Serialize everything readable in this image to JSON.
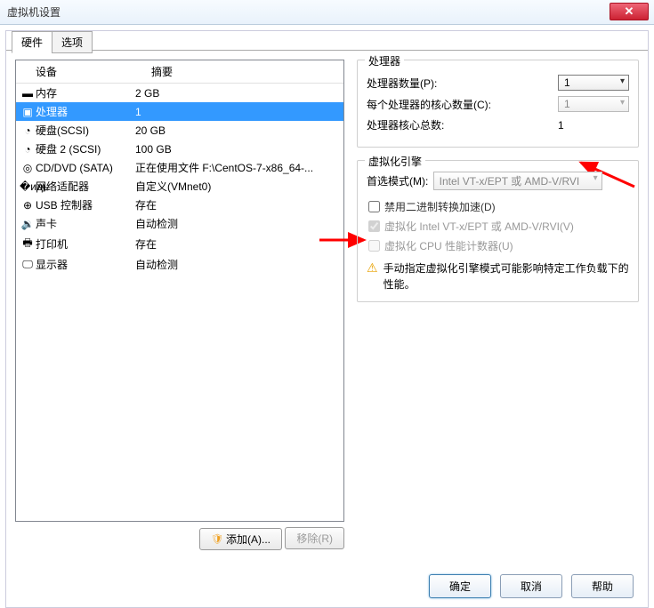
{
  "title": "虚拟机设置",
  "tabs": {
    "hardware": "硬件",
    "options": "选项"
  },
  "list": {
    "head_device": "设备",
    "head_summary": "摘要",
    "rows": [
      {
        "icon": "▬",
        "name": "内存",
        "summary": "2 GB"
      },
      {
        "icon": "▣",
        "name": "处理器",
        "summary": "1"
      },
      {
        "icon": "◔",
        "name": "硬盘(SCSI)",
        "summary": "20 GB"
      },
      {
        "icon": "◔",
        "name": "硬盘 2 (SCSI)",
        "summary": "100 GB"
      },
      {
        "icon": "◎",
        "name": "CD/DVD (SATA)",
        "summary": "正在使用文件 F:\\CentOS-7-x86_64-..."
      },
      {
        "icon": "�идь",
        "name": "网络适配器",
        "summary": "自定义(VMnet0)"
      },
      {
        "icon": "⊕",
        "name": "USB 控制器",
        "summary": "存在"
      },
      {
        "icon": "🔉",
        "name": "声卡",
        "summary": "自动检测"
      },
      {
        "icon": "🖶",
        "name": "打印机",
        "summary": "存在"
      },
      {
        "icon": "🖵",
        "name": "显示器",
        "summary": "自动检测"
      }
    ],
    "add_btn": "添加(A)...",
    "remove_btn": "移除(R)"
  },
  "cpu": {
    "group": "处理器",
    "count_label": "处理器数量(P):",
    "count_value": "1",
    "cores_label": "每个处理器的核心数量(C):",
    "cores_value": "1",
    "total_label": "处理器核心总数:",
    "total_value": "1"
  },
  "ve": {
    "group": "虚拟化引擎",
    "preferred_label": "首选模式(M):",
    "preferred_value": "Intel VT-x/EPT 或 AMD-V/RVI",
    "chk1": "禁用二进制转换加速(D)",
    "chk2": "虚拟化 Intel VT-x/EPT 或 AMD-V/RVI(V)",
    "chk3": "虚拟化 CPU 性能计数器(U)",
    "warn": "手动指定虚拟化引擎模式可能影响特定工作负载下的性能。"
  },
  "footer": {
    "ok": "确定",
    "cancel": "取消",
    "help": "帮助"
  }
}
